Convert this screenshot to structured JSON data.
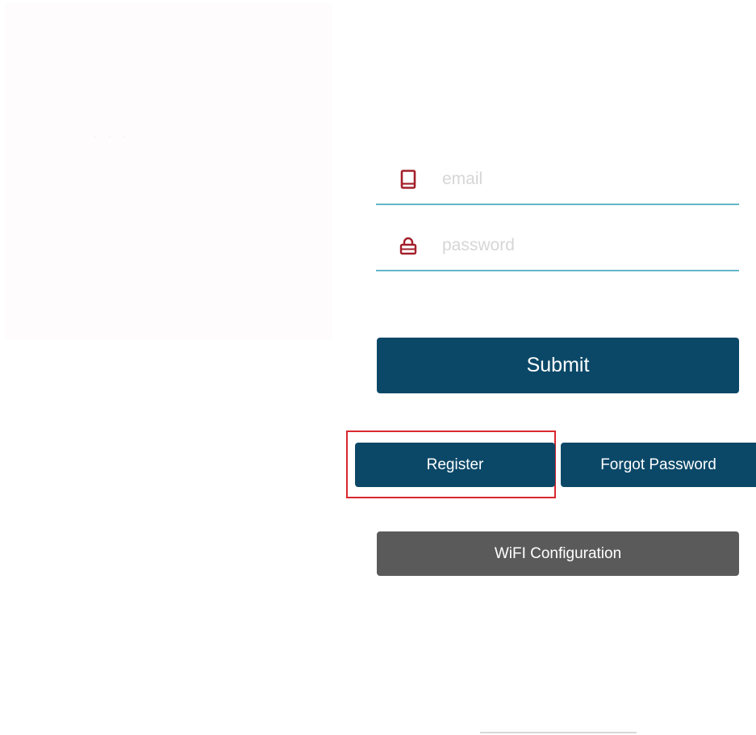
{
  "login": {
    "email_placeholder": "email",
    "password_placeholder": "password",
    "submit_label": "Submit",
    "register_label": "Register",
    "forgot_password_label": "Forgot Password",
    "wifi_configuration_label": "WiFI Configuration"
  },
  "icons": {
    "email": "tablet-icon",
    "password": "lock-icon"
  },
  "colors": {
    "primary_button": "#0b4868",
    "secondary_button": "#5a5a5a",
    "field_underline": "#63b6c9",
    "icon": "#a3202b",
    "highlight": "#d9282f"
  }
}
